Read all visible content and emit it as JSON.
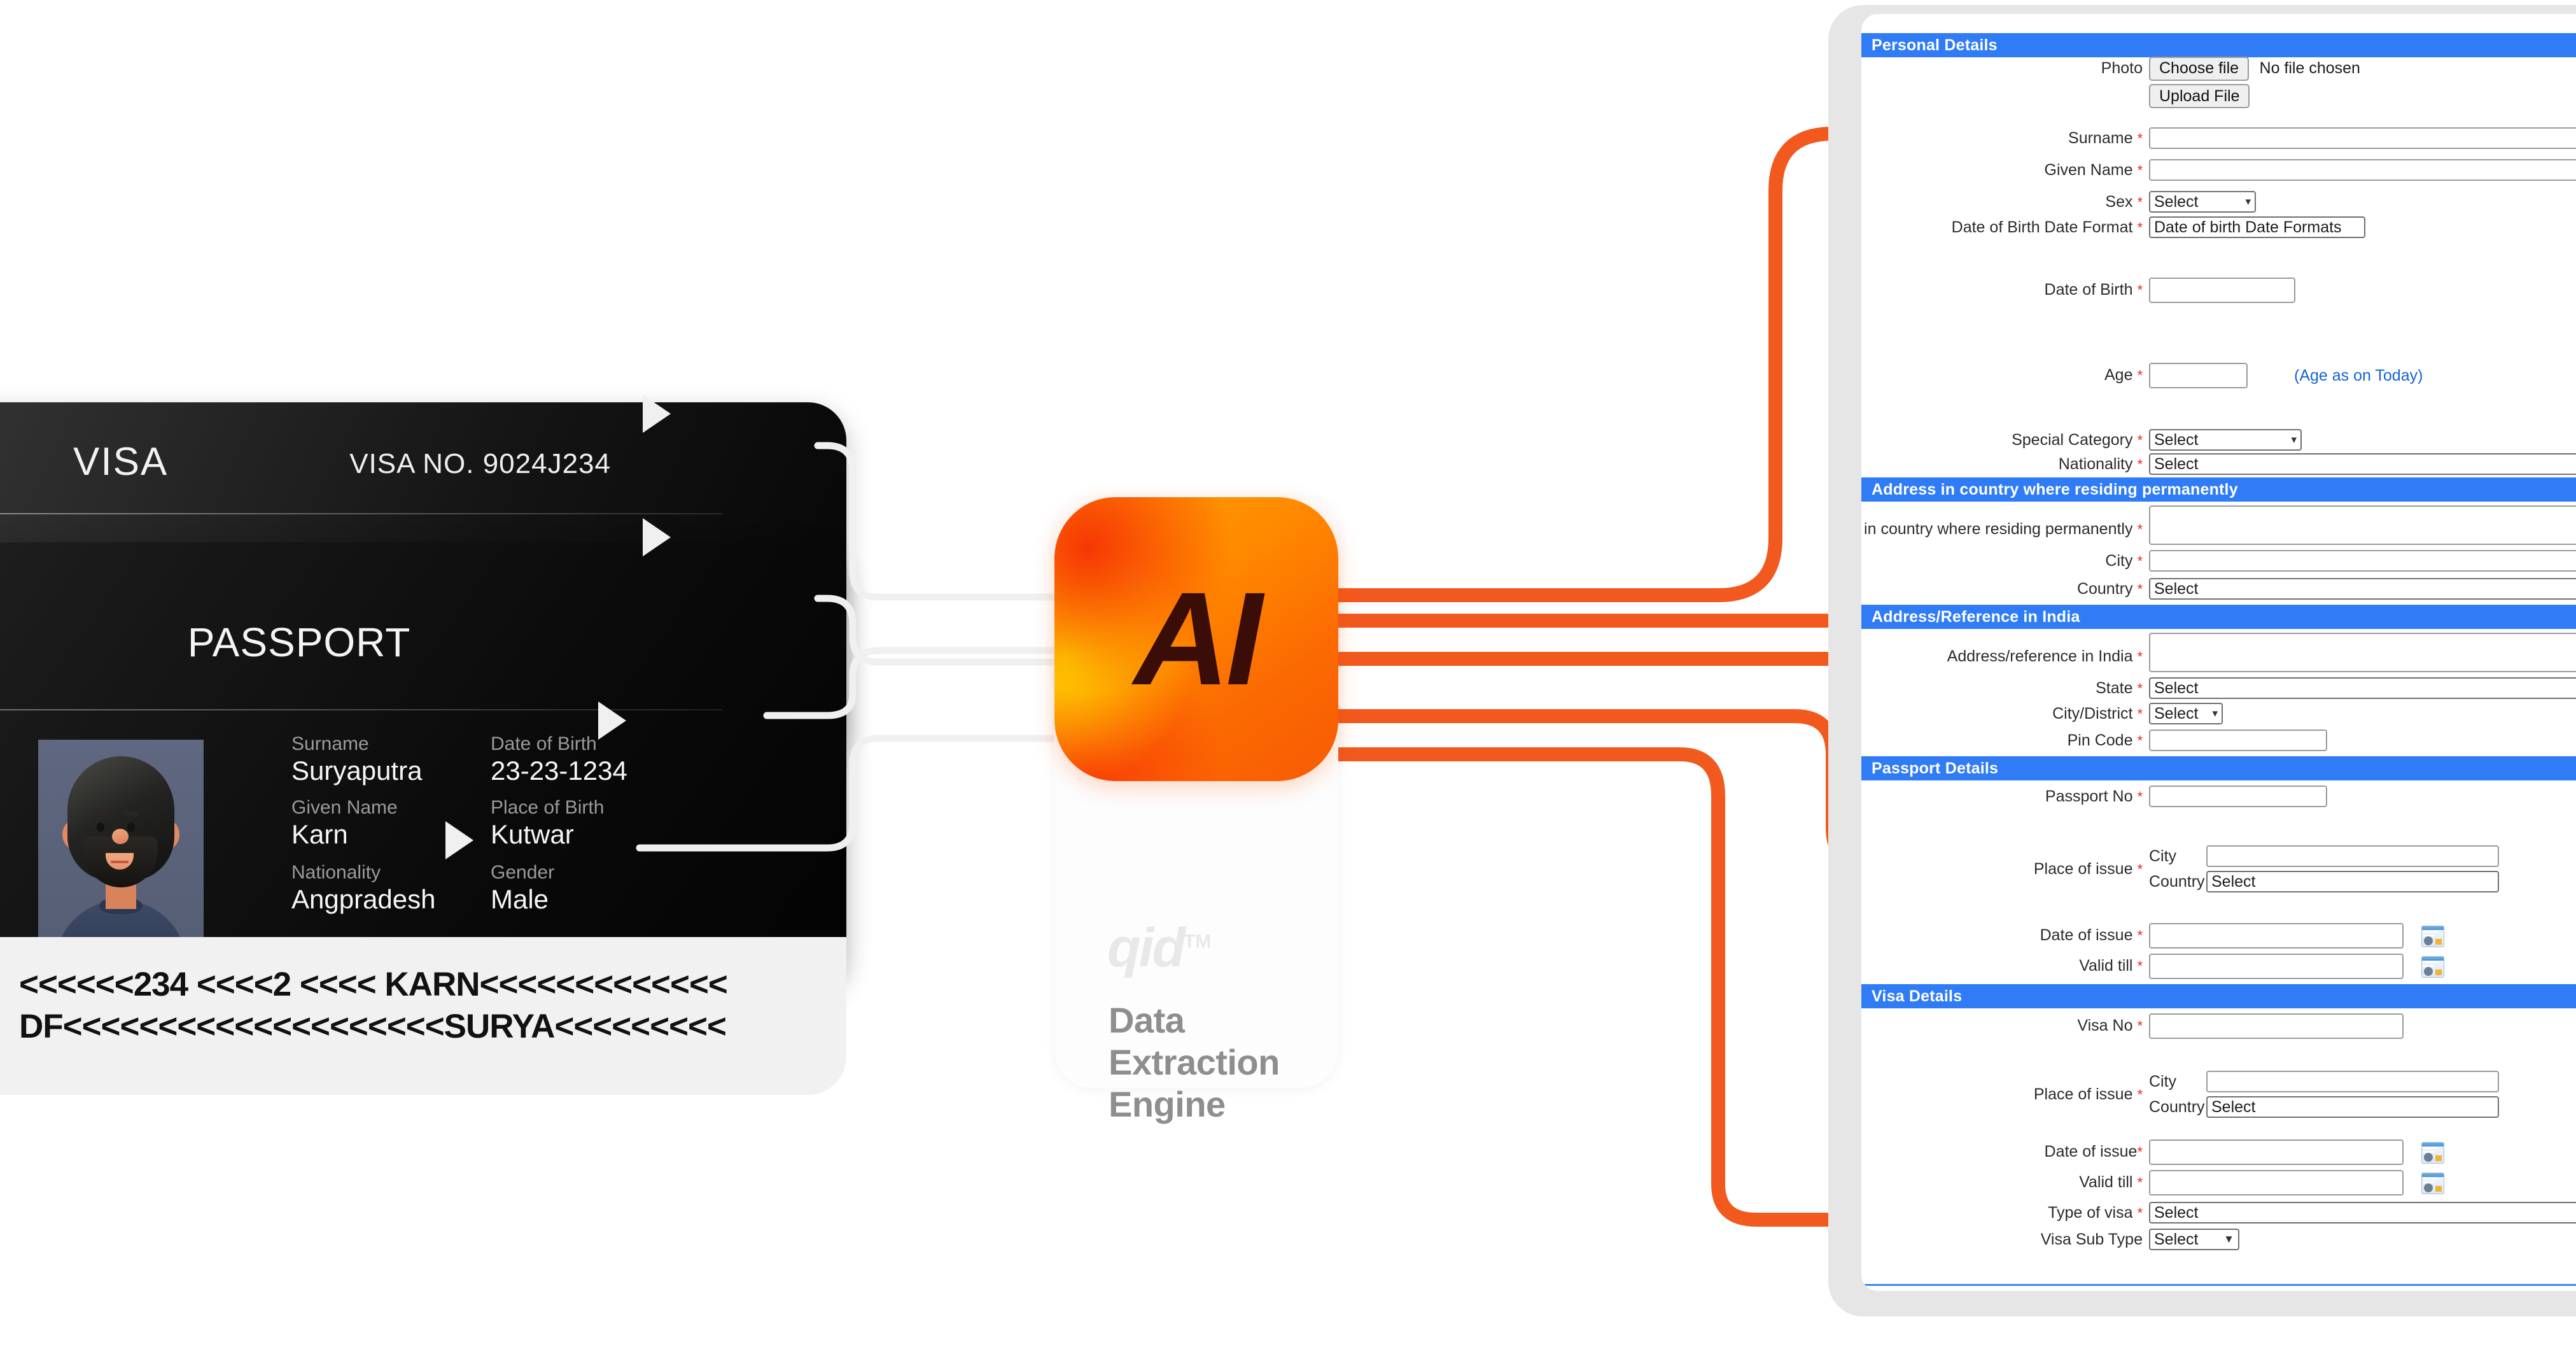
{
  "document_card": {
    "visa": {
      "title": "VISA",
      "visa_no_label": "VISA NO. 9024J234"
    },
    "passport": {
      "title": "PASSPORT",
      "fields": [
        {
          "label": "Surname",
          "value": "Suryaputra"
        },
        {
          "label": "Date of Birth",
          "value": "23-23-1234"
        },
        {
          "label": "Given Name",
          "value": "Karn"
        },
        {
          "label": "Place of Birth",
          "value": "Kutwar"
        },
        {
          "label": "Nationality",
          "value": "Angpradesh"
        },
        {
          "label": "Gender",
          "value": "Male"
        }
      ],
      "mrz_line1": "<<<<<<234 <<<<2 <<<< KARN<<<<<<<<<<<<<",
      "mrz_line2": "DF<<<<<<<<<<<<<<<<<<<<SURYA<<<<<<<<<"
    }
  },
  "engine": {
    "badge_text": "AI",
    "brand": "qid",
    "trademark": "TM",
    "tagline": "Data Extraction Engine"
  },
  "colors": {
    "accent_orange": "#f2591e",
    "section_blue": "#2f7cf6",
    "required_red": "#ee2b12",
    "hint_blue": "#1763d6",
    "logo_orange": "#ff8a00"
  },
  "form": {
    "sections": [
      {
        "title": "Personal Details",
        "fields": [
          {
            "label": "Photo",
            "required": false,
            "type": "file",
            "choose_label": "Choose file",
            "no_file_text": "No file chosen",
            "upload_label": "Upload File"
          },
          {
            "label": "Surname",
            "required": true,
            "type": "text",
            "value": ""
          },
          {
            "label": "Given Name",
            "required": true,
            "type": "text",
            "value": ""
          },
          {
            "label": "Sex",
            "required": true,
            "type": "select",
            "value": "Select"
          },
          {
            "label": "Date of Birth Date Format",
            "required": true,
            "type": "select",
            "value": "Date of birth Date Formats"
          },
          {
            "label": "Date of Birth",
            "required": true,
            "type": "text",
            "value": ""
          },
          {
            "label": "Age",
            "required": true,
            "type": "text",
            "value": "",
            "hint": "(Age as on Today)"
          },
          {
            "label": "Special Category",
            "required": true,
            "type": "select",
            "value": "Select"
          },
          {
            "label": "Nationality",
            "required": true,
            "type": "select",
            "value": "Select"
          }
        ]
      },
      {
        "title": "Address in country where residing permanently",
        "fields": [
          {
            "label": "Address in country where residing permanently",
            "required": true,
            "type": "textarea",
            "value": ""
          },
          {
            "label": "City",
            "required": true,
            "type": "text",
            "value": ""
          },
          {
            "label": "Country",
            "required": true,
            "type": "select",
            "value": "Select"
          }
        ]
      },
      {
        "title": "Address/Reference in India",
        "fields": [
          {
            "label": "Address/reference in India",
            "required": true,
            "type": "textarea",
            "value": ""
          },
          {
            "label": "State",
            "required": true,
            "type": "select",
            "value": "Select"
          },
          {
            "label": "City/District",
            "required": true,
            "type": "select",
            "value": "Select"
          },
          {
            "label": "Pin Code",
            "required": true,
            "type": "text",
            "value": ""
          }
        ]
      },
      {
        "title": "Passport Details",
        "fields": [
          {
            "label": "Passport No",
            "required": true,
            "type": "text",
            "value": ""
          },
          {
            "label": "Place of issue",
            "required": true,
            "type": "group",
            "sub": [
              {
                "label": "City",
                "type": "text",
                "value": ""
              },
              {
                "label": "Country",
                "type": "select",
                "value": "Select"
              }
            ]
          },
          {
            "label": "Date of issue",
            "required": true,
            "type": "date",
            "value": ""
          },
          {
            "label": "Valid till",
            "required": true,
            "type": "date",
            "value": ""
          }
        ]
      },
      {
        "title": "Visa Details",
        "fields": [
          {
            "label": "Visa No",
            "required": true,
            "type": "text",
            "value": ""
          },
          {
            "label": "Place of issue",
            "required": true,
            "type": "group",
            "sub": [
              {
                "label": "City",
                "type": "text",
                "value": ""
              },
              {
                "label": "Country",
                "type": "select",
                "value": "Select"
              }
            ]
          },
          {
            "label": "Date of issue",
            "required": true,
            "type": "date",
            "value": ""
          },
          {
            "label": "Valid till",
            "required": true,
            "type": "date",
            "value": ""
          },
          {
            "label": "Type of visa",
            "required": true,
            "type": "select",
            "value": "Select"
          },
          {
            "label": "Visa Sub Type",
            "required": false,
            "type": "select",
            "value": "Select"
          }
        ]
      }
    ]
  }
}
